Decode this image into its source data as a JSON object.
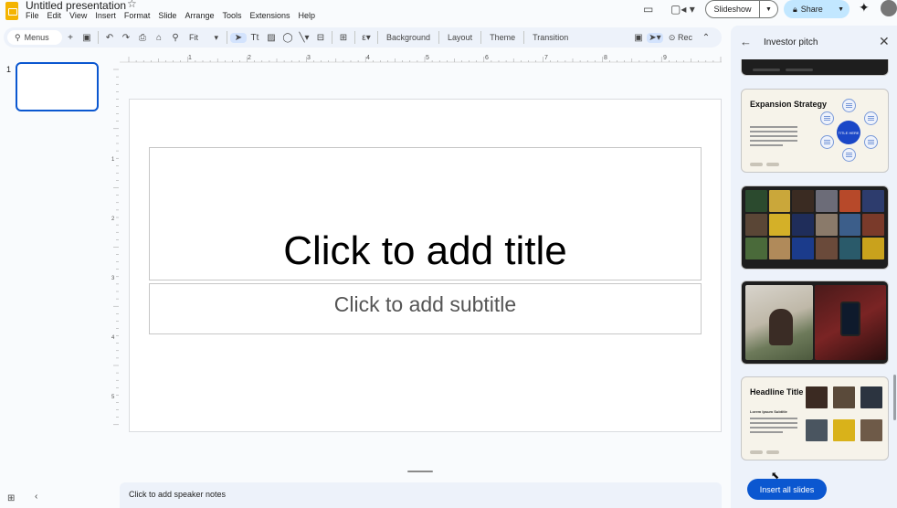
{
  "header": {
    "doc_title": "Untitled presentation",
    "menus": [
      "File",
      "Edit",
      "View",
      "Insert",
      "Format",
      "Slide",
      "Arrange",
      "Tools",
      "Extensions",
      "Help"
    ],
    "slideshow_label": "Slideshow",
    "share_label": "Share"
  },
  "toolbar": {
    "menus_placeholder": "Menus",
    "zoom": "Fit",
    "background_label": "Background",
    "layout_label": "Layout",
    "theme_label": "Theme",
    "transition_label": "Transition",
    "rec_label": "Rec"
  },
  "filmstrip": {
    "slide_number": "1"
  },
  "ruler": {
    "h_ticks": [
      "1",
      "2",
      "3",
      "4",
      "5",
      "6",
      "7",
      "8",
      "9"
    ],
    "v_ticks": [
      "1",
      "2",
      "3",
      "4",
      "5"
    ]
  },
  "slide": {
    "title_placeholder": "Click to add title",
    "subtitle_placeholder": "Click to add subtitle"
  },
  "notes": {
    "placeholder": "Click to add speaker notes"
  },
  "sidepanel": {
    "title": "Investor pitch",
    "cards": [
      {
        "heading": "Expansion Strategy",
        "center_label": "TITLE HERE"
      },
      {
        "heading": "Headline Title Here",
        "subheading": "Lorem Ipsum Subtitle"
      }
    ],
    "insert_button": "Insert all slides"
  },
  "colors": {
    "accent": "#0b57d0",
    "share_bg": "#c2e7ff",
    "toolbar_bg": "#edf2fa"
  }
}
